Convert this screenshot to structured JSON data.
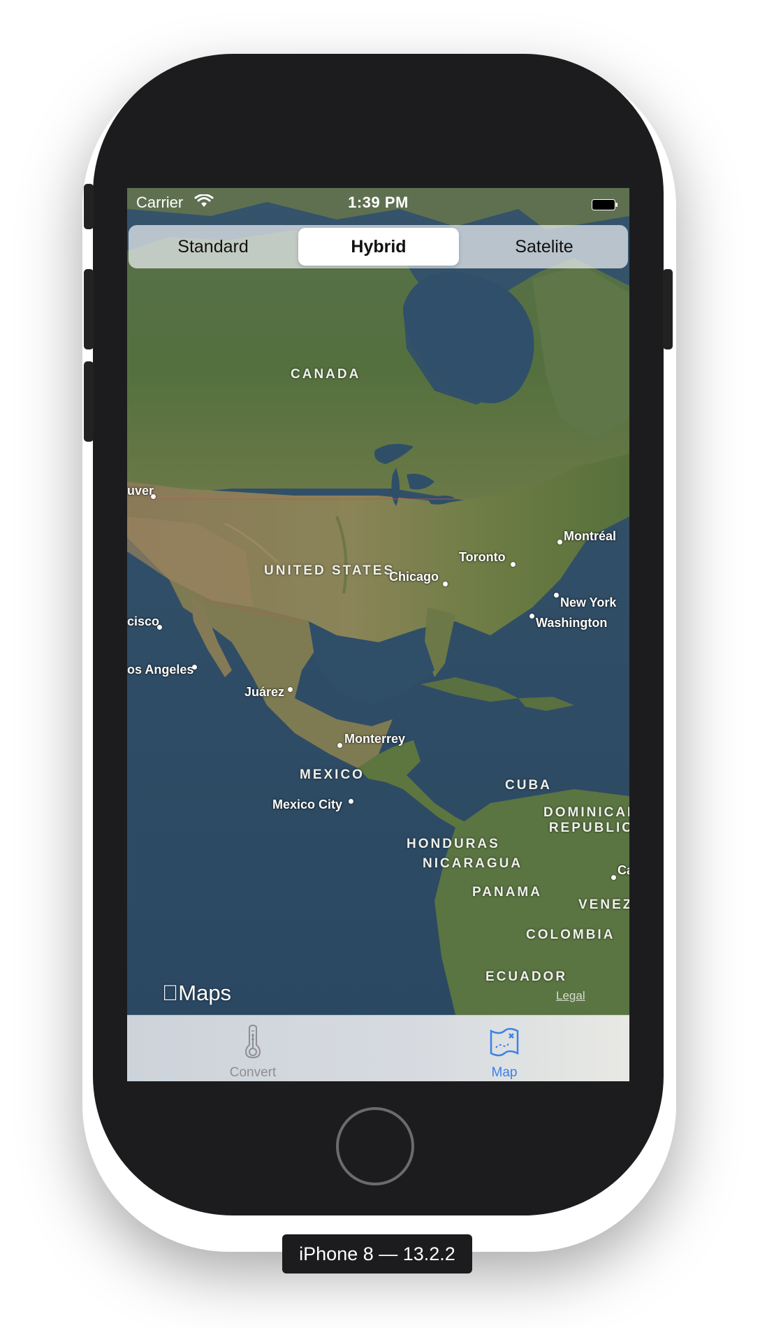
{
  "status_bar": {
    "carrier": "Carrier",
    "time": "1:39 PM",
    "wifi_icon": "wifi-icon",
    "battery_icon": "battery-icon"
  },
  "map_type": {
    "options": [
      "Standard",
      "Hybrid",
      "Satelite"
    ],
    "selected": "Hybrid"
  },
  "map": {
    "countries": {
      "canada": "CANADA",
      "united_states": "UNITED STATES",
      "mexico": "MEXICO",
      "cuba": "CUBA",
      "dominican_republic": "DOMINICAN REPUBLIC",
      "dominican_line1": "DOMINICAN",
      "dominican_line2": "REPUBLIC",
      "honduras": "HONDURAS",
      "nicaragua": "NICARAGUA",
      "panama": "PANAMA",
      "venezuela_partial": "VENEZ",
      "colombia": "COLOMBIA",
      "ecuador": "ECUADOR"
    },
    "cities": {
      "vancouver_partial": "uver",
      "montreal": "Montréal",
      "toronto": "Toronto",
      "chicago": "Chicago",
      "new_york": "New York",
      "washington": "Washington",
      "san_francisco_partial": "cisco",
      "los_angeles_partial": "os Angeles",
      "juarez": "Juárez",
      "monterrey": "Monterrey",
      "mexico_city": "Mexico City",
      "caracas_partial": "Ca"
    },
    "attribution": "Maps",
    "legal": "Legal"
  },
  "tab_bar": {
    "tabs": [
      {
        "label": "Convert",
        "icon": "thermometer-icon",
        "selected": false
      },
      {
        "label": "Map",
        "icon": "map-icon",
        "selected": true
      }
    ],
    "selected_color": "#3a82e8",
    "unselected_color": "#8e8e93"
  },
  "device_caption": "iPhone 8 — 13.2.2"
}
